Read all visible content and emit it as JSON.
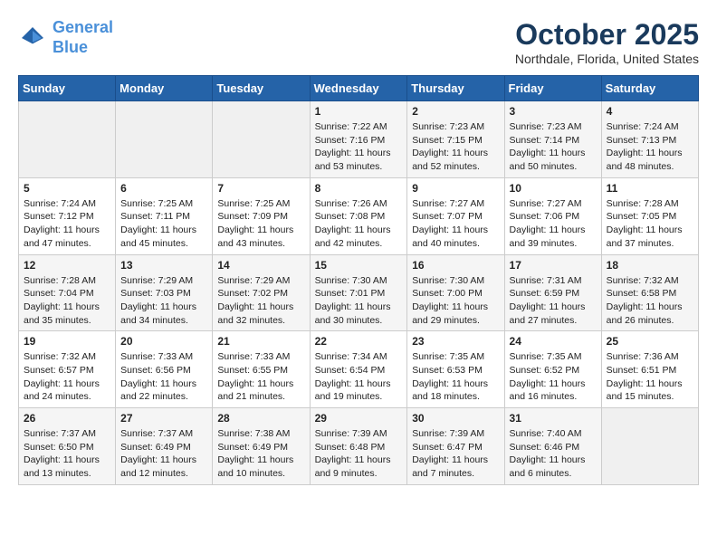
{
  "header": {
    "logo_line1": "General",
    "logo_line2": "Blue",
    "month": "October 2025",
    "location": "Northdale, Florida, United States"
  },
  "days_of_week": [
    "Sunday",
    "Monday",
    "Tuesday",
    "Wednesday",
    "Thursday",
    "Friday",
    "Saturday"
  ],
  "weeks": [
    [
      {
        "day": "",
        "content": ""
      },
      {
        "day": "",
        "content": ""
      },
      {
        "day": "",
        "content": ""
      },
      {
        "day": "1",
        "content": "Sunrise: 7:22 AM\nSunset: 7:16 PM\nDaylight: 11 hours and 53 minutes."
      },
      {
        "day": "2",
        "content": "Sunrise: 7:23 AM\nSunset: 7:15 PM\nDaylight: 11 hours and 52 minutes."
      },
      {
        "day": "3",
        "content": "Sunrise: 7:23 AM\nSunset: 7:14 PM\nDaylight: 11 hours and 50 minutes."
      },
      {
        "day": "4",
        "content": "Sunrise: 7:24 AM\nSunset: 7:13 PM\nDaylight: 11 hours and 48 minutes."
      }
    ],
    [
      {
        "day": "5",
        "content": "Sunrise: 7:24 AM\nSunset: 7:12 PM\nDaylight: 11 hours and 47 minutes."
      },
      {
        "day": "6",
        "content": "Sunrise: 7:25 AM\nSunset: 7:11 PM\nDaylight: 11 hours and 45 minutes."
      },
      {
        "day": "7",
        "content": "Sunrise: 7:25 AM\nSunset: 7:09 PM\nDaylight: 11 hours and 43 minutes."
      },
      {
        "day": "8",
        "content": "Sunrise: 7:26 AM\nSunset: 7:08 PM\nDaylight: 11 hours and 42 minutes."
      },
      {
        "day": "9",
        "content": "Sunrise: 7:27 AM\nSunset: 7:07 PM\nDaylight: 11 hours and 40 minutes."
      },
      {
        "day": "10",
        "content": "Sunrise: 7:27 AM\nSunset: 7:06 PM\nDaylight: 11 hours and 39 minutes."
      },
      {
        "day": "11",
        "content": "Sunrise: 7:28 AM\nSunset: 7:05 PM\nDaylight: 11 hours and 37 minutes."
      }
    ],
    [
      {
        "day": "12",
        "content": "Sunrise: 7:28 AM\nSunset: 7:04 PM\nDaylight: 11 hours and 35 minutes."
      },
      {
        "day": "13",
        "content": "Sunrise: 7:29 AM\nSunset: 7:03 PM\nDaylight: 11 hours and 34 minutes."
      },
      {
        "day": "14",
        "content": "Sunrise: 7:29 AM\nSunset: 7:02 PM\nDaylight: 11 hours and 32 minutes."
      },
      {
        "day": "15",
        "content": "Sunrise: 7:30 AM\nSunset: 7:01 PM\nDaylight: 11 hours and 30 minutes."
      },
      {
        "day": "16",
        "content": "Sunrise: 7:30 AM\nSunset: 7:00 PM\nDaylight: 11 hours and 29 minutes."
      },
      {
        "day": "17",
        "content": "Sunrise: 7:31 AM\nSunset: 6:59 PM\nDaylight: 11 hours and 27 minutes."
      },
      {
        "day": "18",
        "content": "Sunrise: 7:32 AM\nSunset: 6:58 PM\nDaylight: 11 hours and 26 minutes."
      }
    ],
    [
      {
        "day": "19",
        "content": "Sunrise: 7:32 AM\nSunset: 6:57 PM\nDaylight: 11 hours and 24 minutes."
      },
      {
        "day": "20",
        "content": "Sunrise: 7:33 AM\nSunset: 6:56 PM\nDaylight: 11 hours and 22 minutes."
      },
      {
        "day": "21",
        "content": "Sunrise: 7:33 AM\nSunset: 6:55 PM\nDaylight: 11 hours and 21 minutes."
      },
      {
        "day": "22",
        "content": "Sunrise: 7:34 AM\nSunset: 6:54 PM\nDaylight: 11 hours and 19 minutes."
      },
      {
        "day": "23",
        "content": "Sunrise: 7:35 AM\nSunset: 6:53 PM\nDaylight: 11 hours and 18 minutes."
      },
      {
        "day": "24",
        "content": "Sunrise: 7:35 AM\nSunset: 6:52 PM\nDaylight: 11 hours and 16 minutes."
      },
      {
        "day": "25",
        "content": "Sunrise: 7:36 AM\nSunset: 6:51 PM\nDaylight: 11 hours and 15 minutes."
      }
    ],
    [
      {
        "day": "26",
        "content": "Sunrise: 7:37 AM\nSunset: 6:50 PM\nDaylight: 11 hours and 13 minutes."
      },
      {
        "day": "27",
        "content": "Sunrise: 7:37 AM\nSunset: 6:49 PM\nDaylight: 11 hours and 12 minutes."
      },
      {
        "day": "28",
        "content": "Sunrise: 7:38 AM\nSunset: 6:49 PM\nDaylight: 11 hours and 10 minutes."
      },
      {
        "day": "29",
        "content": "Sunrise: 7:39 AM\nSunset: 6:48 PM\nDaylight: 11 hours and 9 minutes."
      },
      {
        "day": "30",
        "content": "Sunrise: 7:39 AM\nSunset: 6:47 PM\nDaylight: 11 hours and 7 minutes."
      },
      {
        "day": "31",
        "content": "Sunrise: 7:40 AM\nSunset: 6:46 PM\nDaylight: 11 hours and 6 minutes."
      },
      {
        "day": "",
        "content": ""
      }
    ]
  ]
}
